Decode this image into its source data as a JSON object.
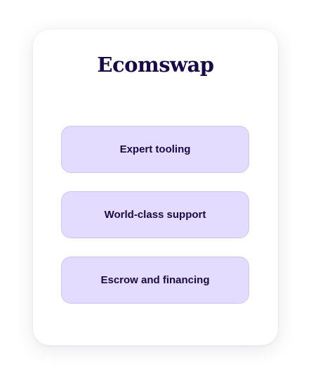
{
  "brand": {
    "name": "Ecomswap"
  },
  "features": [
    {
      "label": "Expert tooling"
    },
    {
      "label": "World-class support"
    },
    {
      "label": "Escrow and financing"
    }
  ],
  "colors": {
    "brand_text": "#1a0a44",
    "feature_bg": "#e3dcff",
    "feature_border": "#cfc6ee"
  }
}
